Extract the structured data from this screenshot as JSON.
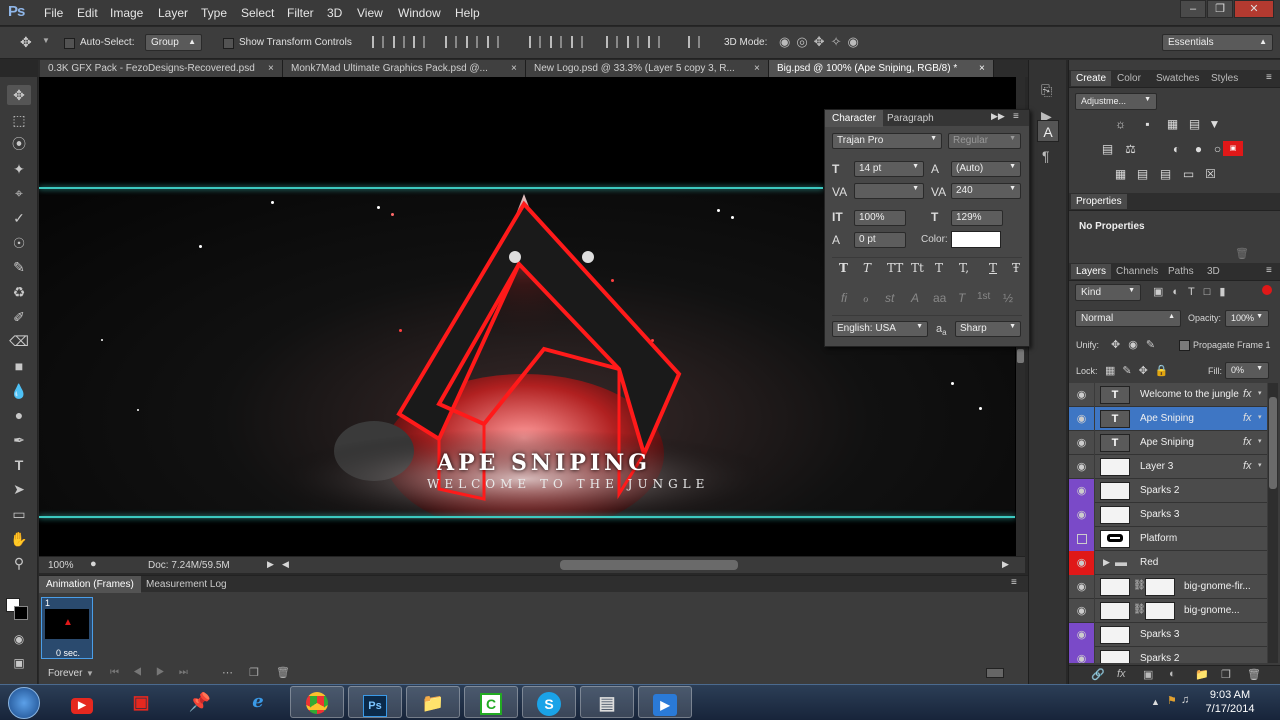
{
  "app": {
    "logo": "Ps"
  },
  "menu": [
    "File",
    "Edit",
    "Image",
    "Layer",
    "Type",
    "Select",
    "Filter",
    "3D",
    "View",
    "Window",
    "Help"
  ],
  "options": {
    "auto_select_label": "Auto-Select:",
    "auto_select_value": "Group",
    "show_transform_label": "Show Transform Controls",
    "mode_3d_label": "3D Mode:",
    "workspace": "Essentials"
  },
  "doc_tabs": [
    "0.3K GFX Pack - FezoDesigns-Recovered.psd",
    "Monk7Mad Ultimate Graphics Pack.psd @...",
    "New Logo.psd @ 33.3% (Layer 5 copy 3, R...",
    "Big.psd @ 100% (Ape Sniping, RGB/8) *"
  ],
  "canvas": {
    "title": "Ape Sniping",
    "subtitle": "Welcome to the jungle",
    "colors": {
      "accent_line": "#3cc9c0",
      "logo_red": "#e01818"
    }
  },
  "status": {
    "zoom": "100%",
    "doc_size": "Doc: 7.24M/59.5M"
  },
  "anim_panel": {
    "tabs": [
      "Animation (Frames)",
      "Measurement Log"
    ],
    "frame_number": "1",
    "frame_delay": "0 sec.",
    "loop": "Forever"
  },
  "character": {
    "tabs": [
      "Character",
      "Paragraph"
    ],
    "font_family": "Trajan Pro",
    "font_style": "Regular",
    "size": "14 pt",
    "leading": "(Auto)",
    "tracking": "240",
    "vscale": "100%",
    "hscale": "129%",
    "baseline": "0 pt",
    "color_label": "Color:",
    "language": "English: USA",
    "aa_label": "a",
    "antialias": "Sharp",
    "style_buttons": [
      "T",
      "T",
      "TT",
      "Tt",
      "T",
      "T,",
      "T",
      "Ŧ"
    ],
    "ot_buttons": [
      "fi",
      "ℴ",
      "st",
      "A",
      "aa",
      "T",
      "1st",
      "½"
    ]
  },
  "right_panel": {
    "top_tabs": [
      "Create",
      "Color",
      "Swatches",
      "Styles"
    ],
    "adjust_dd": "Adjustme...",
    "properties_tab": "Properties",
    "no_properties": "No Properties",
    "layer_tabs": [
      "Layers",
      "Channels",
      "Paths",
      "3D"
    ],
    "kind": "Kind",
    "blend": "Normal",
    "opacity_label": "Opacity:",
    "opacity": "100%",
    "unify_label": "Unify:",
    "propagate_label": "Propagate Frame 1",
    "lock_label": "Lock:",
    "fill_label": "Fill:",
    "fill": "0%"
  },
  "layers": [
    {
      "name": "Welcome to the jungle",
      "eye": "visible",
      "type": "text",
      "fx": true,
      "selected": false
    },
    {
      "name": "Ape Sniping",
      "eye": "visible",
      "type": "text",
      "fx": true,
      "selected": true
    },
    {
      "name": "Ape Sniping",
      "eye": "visible",
      "type": "text",
      "fx": true,
      "selected": false
    },
    {
      "name": "Layer 3",
      "eye": "visible",
      "type": "pixel",
      "fx": true,
      "selected": false
    },
    {
      "name": "Sparks 2",
      "eye": "purple",
      "type": "pixel",
      "fx": false,
      "selected": false
    },
    {
      "name": "Sparks 3",
      "eye": "purple",
      "type": "pixel",
      "fx": false,
      "selected": false
    },
    {
      "name": "Platform",
      "eye": "purple-hidden",
      "type": "shape",
      "fx": false,
      "selected": false
    },
    {
      "name": "Red",
      "eye": "red",
      "type": "group",
      "fx": false,
      "selected": false
    },
    {
      "name": "big-gnome-fir...",
      "eye": "visible",
      "type": "mask",
      "fx": false,
      "selected": false
    },
    {
      "name": "big-gnome...",
      "eye": "visible",
      "type": "mask",
      "fx": false,
      "selected": false
    },
    {
      "name": "Sparks 3",
      "eye": "purple",
      "type": "pixel",
      "fx": false,
      "selected": false
    },
    {
      "name": "Sparks 2",
      "eye": "purple",
      "type": "pixel",
      "fx": false,
      "selected": false
    }
  ],
  "taskbar": {
    "apps": [
      "windows-start",
      "youtube",
      "toolbox",
      "pin",
      "internet-explorer",
      "chrome",
      "photoshop",
      "folder",
      "camtasia",
      "skype",
      "calendar",
      "media-player"
    ],
    "ps_label": "Ps",
    "time": "9:03 AM",
    "date": "7/17/2014"
  }
}
